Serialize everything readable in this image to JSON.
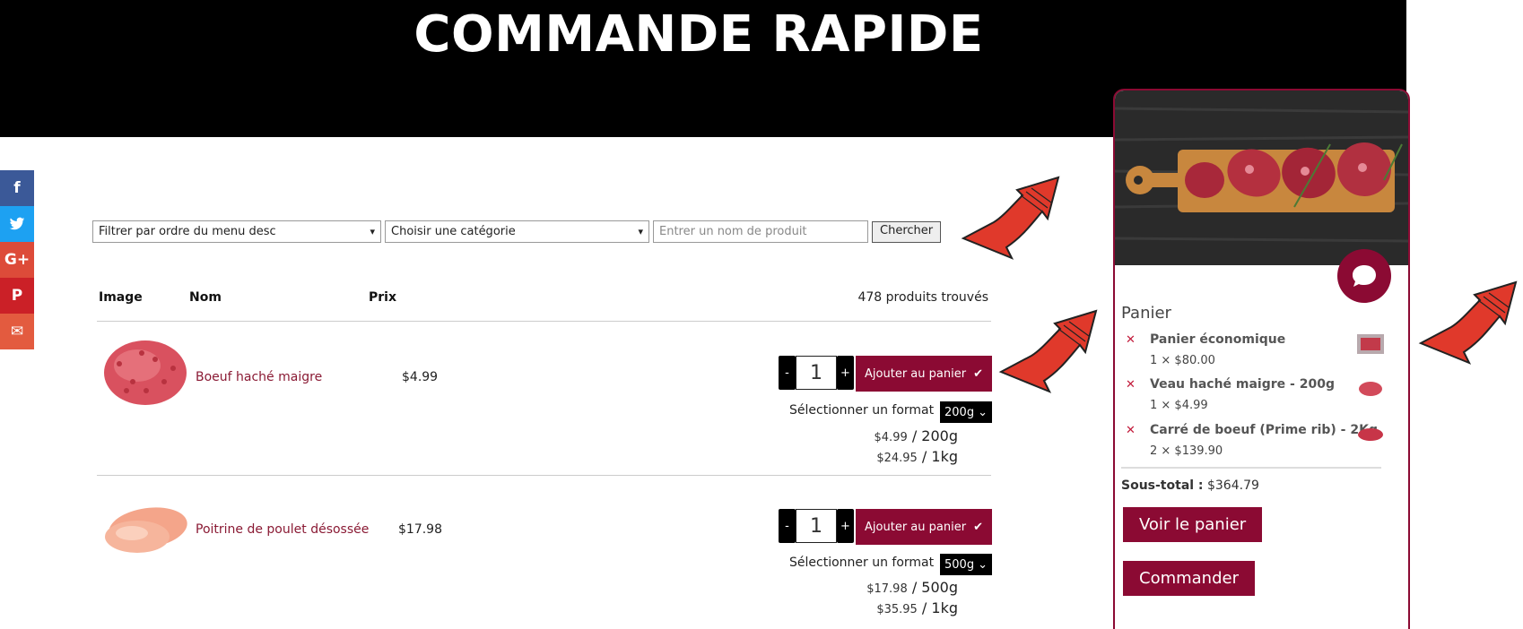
{
  "header": {
    "title": "COMMANDE RAPIDE"
  },
  "social": [
    {
      "icon": "facebook-icon",
      "glyph": "f",
      "color": "#3b5998"
    },
    {
      "icon": "twitter-icon",
      "glyph": "t",
      "color": "#1da1f2"
    },
    {
      "icon": "google-plus-icon",
      "glyph": "G+",
      "color": "#dd4b39"
    },
    {
      "icon": "pinterest-icon",
      "glyph": "P",
      "color": "#cb2027"
    },
    {
      "icon": "email-icon",
      "glyph": "✉",
      "color": "#e35b3f"
    }
  ],
  "filters": {
    "order_select": "Filtrer par ordre du menu desc",
    "category_select": "Choisir une catégorie",
    "search_placeholder": "Entrer un nom de produit",
    "search_button": "Chercher"
  },
  "table": {
    "headers": {
      "image": "Image",
      "name": "Nom",
      "price": "Prix"
    },
    "count_text": "478 produits trouvés"
  },
  "products": [
    {
      "name": "Boeuf haché maigre",
      "price": "$4.99",
      "qty": "1",
      "add_label": "Ajouter au panier",
      "format_label": "Sélectionner un format",
      "format_value": "200g",
      "price_line1_amount": "$4.99",
      "price_line1_unit": " / 200g",
      "price_line2_amount": "$24.95",
      "price_line2_unit": " / 1kg"
    },
    {
      "name": "Poitrine de poulet désossée",
      "price": "$17.98",
      "qty": "1",
      "add_label": "Ajouter au panier",
      "format_label": "Sélectionner un format",
      "format_value": "500g",
      "price_line1_amount": "$17.98",
      "price_line1_unit": " / 500g",
      "price_line2_amount": "$35.95",
      "price_line2_unit": " / 1kg"
    }
  ],
  "cart": {
    "title": "Panier",
    "items": [
      {
        "name": "Panier économique",
        "qty_line": "1 × $80.00"
      },
      {
        "name": "Veau haché maigre - 200g",
        "qty_line": "1 × $4.99"
      },
      {
        "name": "Carré de boeuf (Prime rib) - 2Kg",
        "qty_line": "2 × $139.90"
      }
    ],
    "subtotal_label": "Sous-total :",
    "subtotal_value": " $364.79",
    "view_cart": "Voir le panier",
    "checkout": "Commander"
  },
  "colors": {
    "accent": "#8b0a33",
    "arrow": "#e0392b"
  }
}
